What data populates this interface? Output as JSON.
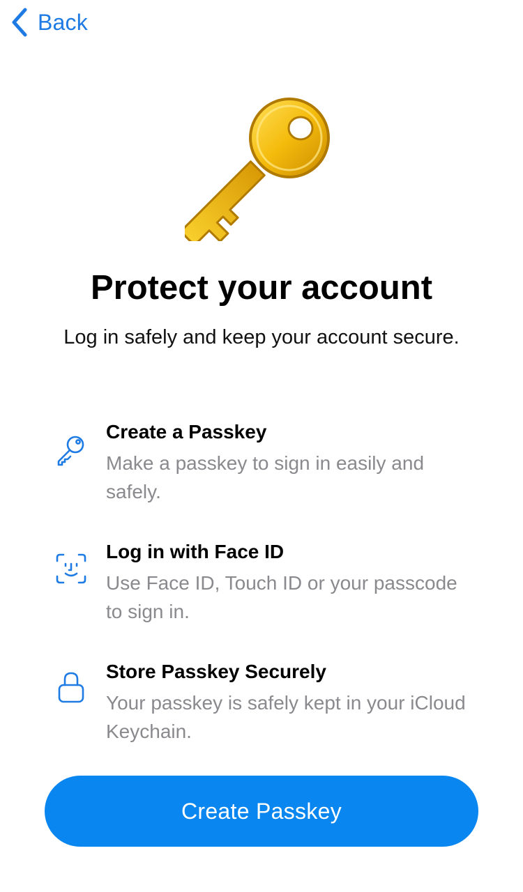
{
  "nav": {
    "back_label": "Back"
  },
  "hero": {
    "icon": "golden-key-icon"
  },
  "header": {
    "title": "Protect your account",
    "subtitle": "Log in safely and keep your account secure."
  },
  "features": [
    {
      "icon": "key-icon",
      "title": "Create a Passkey",
      "description": "Make a passkey to sign in easily and safely."
    },
    {
      "icon": "face-id-icon",
      "title": "Log in with Face ID",
      "description": "Use Face ID, Touch ID or your passcode to sign in."
    },
    {
      "icon": "lock-icon",
      "title": "Store Passkey Securely",
      "description": "Your passkey is safely kept in your iCloud Keychain."
    }
  ],
  "primary_action": {
    "label": "Create Passkey"
  },
  "colors": {
    "accent": "#1f7be4",
    "button": "#0a86f0",
    "secondary_text": "#8a8a8e",
    "key_gold": "#f2b705"
  }
}
